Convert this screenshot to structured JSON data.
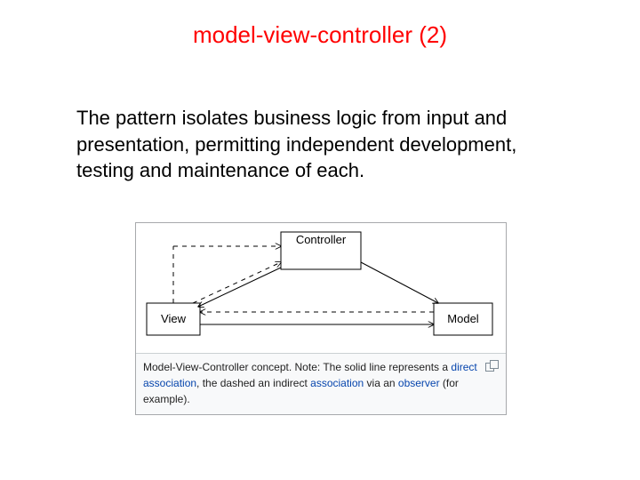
{
  "title": "model-view-controller (2)",
  "body": "The pattern isolates business logic from input and presentation, permitting independent development, testing and maintenance of each.",
  "diagram": {
    "controller": "Controller",
    "view": "View",
    "model": "Model"
  },
  "caption": {
    "p1": "Model-View-Controller concept. Note: The solid line represents a ",
    "l1": "direct ",
    "l1b": "association",
    "p2": ", the dashed an indirect ",
    "l2": "association",
    "p3": " via an ",
    "l3": "observer",
    "p4": " (for example)."
  }
}
